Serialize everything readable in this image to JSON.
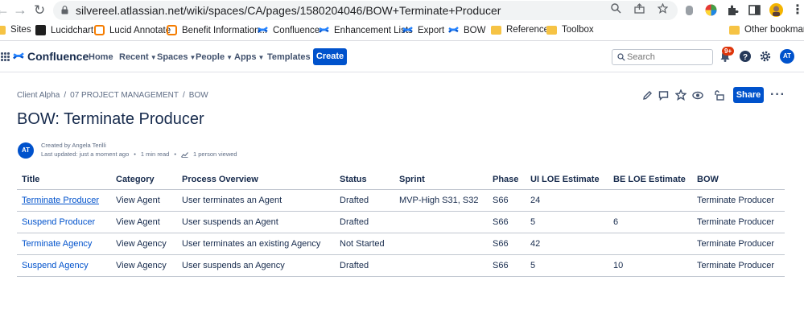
{
  "browser": {
    "url": "silvereel.atlassian.net/wiki/spaces/CA/pages/1580204046/BOW+Terminate+Producer"
  },
  "bookmarks": {
    "items": [
      "Sites",
      "Lucidchart",
      "Lucid Annotate",
      "Benefit Information...",
      "Confluence",
      "Enhancement Lists",
      "Export",
      "BOW",
      "Reference",
      "Toolbox"
    ],
    "other": "Other bookmarks"
  },
  "nav": {
    "logo": "Confluence",
    "home": "Home",
    "recent": "Recent",
    "spaces": "Spaces",
    "people": "People",
    "apps": "Apps",
    "templates": "Templates",
    "create": "Create",
    "search_placeholder": "Search",
    "notifications_badge": "9+",
    "avatar_initials": "AT"
  },
  "page": {
    "breadcrumb": [
      "Client Alpha",
      "07 PROJECT MANAGEMENT",
      "BOW"
    ],
    "share": "Share",
    "title": "BOW: Terminate Producer",
    "author_initials": "AT",
    "created_by": "Created by Angela Terilli",
    "last_updated": "Last updated: just a moment ago",
    "read_time": "1 min read",
    "viewed": "1 person viewed"
  },
  "table": {
    "headers": [
      "Title",
      "Category",
      "Process Overview",
      "Status",
      "Sprint",
      "Phase",
      "UI LOE Estimate",
      "BE LOE Estimate",
      "BOW"
    ],
    "rows": [
      [
        "Terminate Producer",
        "View Agent",
        "User terminates an Agent",
        "Drafted",
        "MVP-High S31, S32",
        "S66",
        "24",
        "",
        "Terminate Producer"
      ],
      [
        "Suspend Producer",
        "View Agent",
        "User suspends an Agent",
        "Drafted",
        "",
        "S66",
        "5",
        "6",
        "Terminate Producer"
      ],
      [
        "Terminate Agency",
        "View Agency",
        "User terminates an existing Agency",
        "Not Started",
        "",
        "S66",
        "42",
        "",
        "Terminate Producer"
      ],
      [
        "Suspend Agency",
        "View Agency",
        "User suspends an Agency",
        "Drafted",
        "",
        "S66",
        "5",
        "10",
        "Terminate Producer"
      ]
    ]
  },
  "colors": {
    "primary": "#0052cc",
    "text": "#172b4d",
    "subtle": "#5e6c84"
  }
}
